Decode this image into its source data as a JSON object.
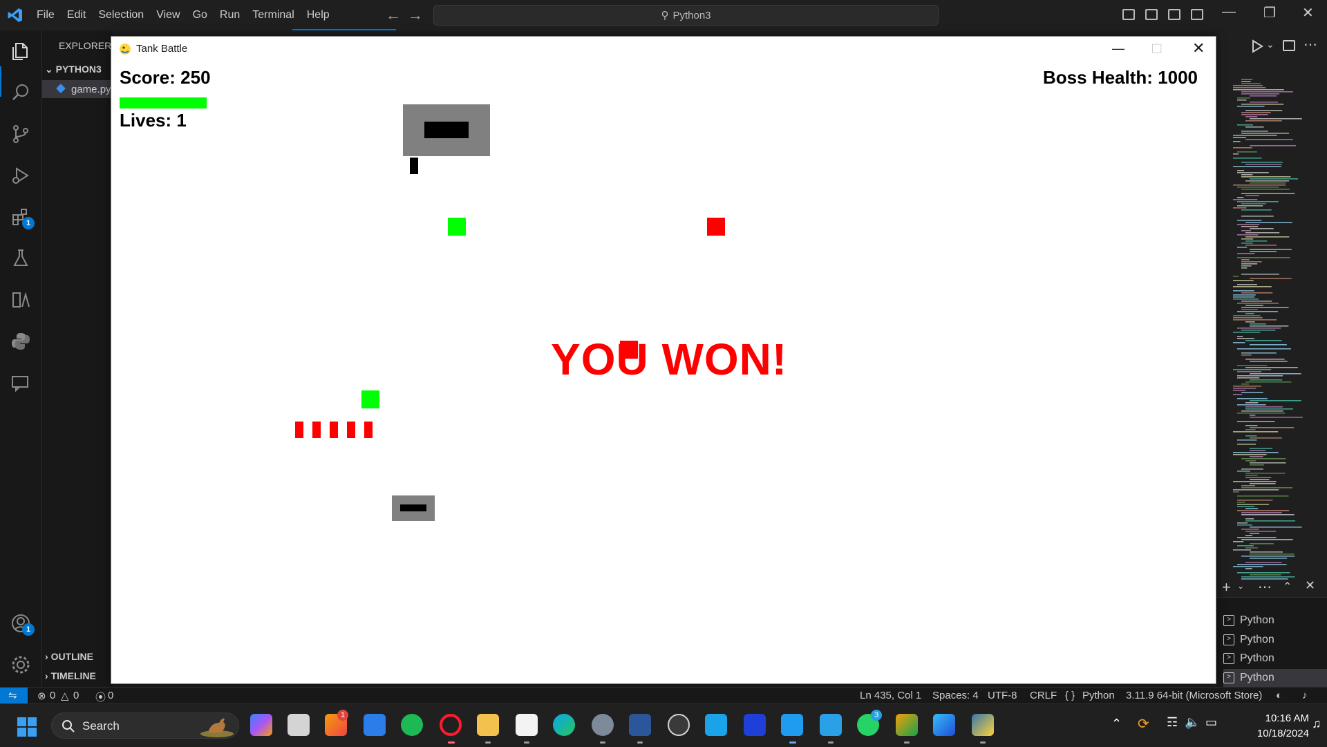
{
  "vscode": {
    "menu": [
      "File",
      "Edit",
      "Selection",
      "View",
      "Go",
      "Run",
      "Terminal",
      "Help"
    ],
    "command_center": "Python3",
    "explorer": {
      "title": "EXPLORER",
      "folder": "PYTHON3",
      "file": "game.py",
      "outline": "OUTLINE",
      "timeline": "TIMELINE"
    },
    "activity_badges": {
      "extensions": "1",
      "accounts": "1"
    },
    "terminals": [
      "Python",
      "Python",
      "Python",
      "Python"
    ],
    "statusbar": {
      "errors": "0",
      "warnings": "0",
      "ports": "0",
      "cursor": "Ln 435, Col 1",
      "spaces": "Spaces: 4",
      "encoding": "UTF-8",
      "eol": "CRLF",
      "language": "Python",
      "interpreter": "3.11.9 64-bit (Microsoft Store)"
    }
  },
  "game": {
    "window_title": "Tank Battle",
    "score": "Score: 250",
    "lives": "Lives: 1",
    "boss_health": "Boss Health: 1000",
    "message": "YOU WON!",
    "health_bar_fraction": 1.0,
    "colors": {
      "player_health": "#00ff00",
      "message": "#ff0000",
      "tank": "#808080",
      "enemy_bullet": "#ff0000",
      "powerup": "#00ff00"
    }
  },
  "taskbar": {
    "search_label": "Search",
    "time": "10:16 AM",
    "date": "10/18/2024",
    "badges": {
      "notes_app": "1",
      "whatsapp": "3"
    }
  },
  "colors": {
    "accent": "#0078d4",
    "editor_bg": "#1f1f1f"
  }
}
